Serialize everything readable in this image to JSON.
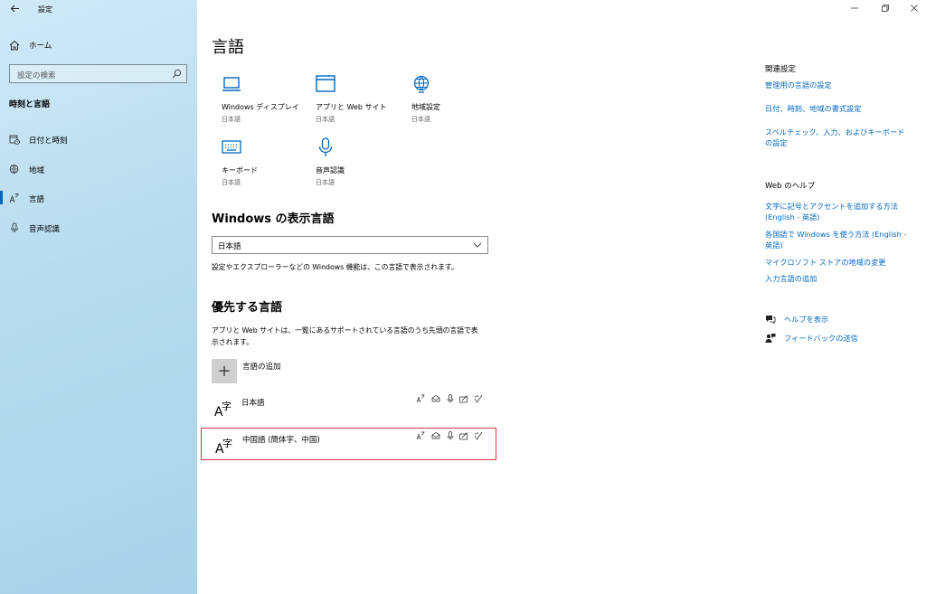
{
  "window": {
    "title": "設定",
    "controls": {
      "minimize": "—",
      "restore": "❐",
      "close": "✕"
    }
  },
  "sidebar": {
    "home": "ホーム",
    "search_placeholder": "設定の検索",
    "section": "時刻と言語",
    "items": [
      {
        "label": "日付と時刻",
        "icon": "calendar-clock-icon"
      },
      {
        "label": "地域",
        "icon": "globe-pin-icon"
      },
      {
        "label": "言語",
        "icon": "language-icon",
        "selected": true
      },
      {
        "label": "音声認識",
        "icon": "microphone-icon"
      }
    ]
  },
  "main": {
    "title": "言語",
    "tiles": [
      {
        "name": "Windows ディスプレイ",
        "sub": "日本語",
        "icon": "laptop-icon"
      },
      {
        "name": "アプリと Web サイト",
        "sub": "日本語",
        "icon": "window-icon"
      },
      {
        "name": "地域設定",
        "sub": "日本語",
        "icon": "globe-icon"
      },
      {
        "name": "キーボード",
        "sub": "日本語",
        "icon": "keyboard-icon"
      },
      {
        "name": "音声認識",
        "sub": "日本語",
        "icon": "microphone-icon"
      }
    ],
    "display_language": {
      "heading": "Windows の表示言語",
      "selected": "日本語",
      "description": "設定やエクスプローラーなどの Windows 機能は、この言語で表示されます。"
    },
    "preferred": {
      "heading": "優先する言語",
      "description_line1": "アプリと Web サイトは、一覧にあるサポートされている言語のうち先頭の言語で表",
      "description_line2": "示されます。",
      "add_label": "言語の追加",
      "add_symbol": "+",
      "languages": [
        {
          "name": "日本語",
          "highlighted": false
        },
        {
          "name": "中国語 (簡体字、中国)",
          "highlighted": true
        }
      ],
      "lang_glyph_a": "A",
      "lang_glyph_zi": "字"
    }
  },
  "related": {
    "heading": "関連設定",
    "links": [
      "管理用の言語の設定",
      "日付、時刻、地域の書式設定",
      "スペルチェック、入力、およびキーボードの設定"
    ]
  },
  "web_help": {
    "heading": "Web のヘルプ",
    "links": [
      "文字に記号とアクセントを追加する方法 (English - 英語)",
      "各国語で Windows を使う方法 (English - 英語)",
      "マイクロソフト ストアの地域の変更",
      "入力言語の追加"
    ]
  },
  "help": {
    "show_help": "ヘルプを表示",
    "feedback": "フィードバックの送信"
  },
  "colors": {
    "accent": "#0067c0",
    "highlight_border": "#e2323c",
    "sidebar_bg": "#b7dbee"
  }
}
